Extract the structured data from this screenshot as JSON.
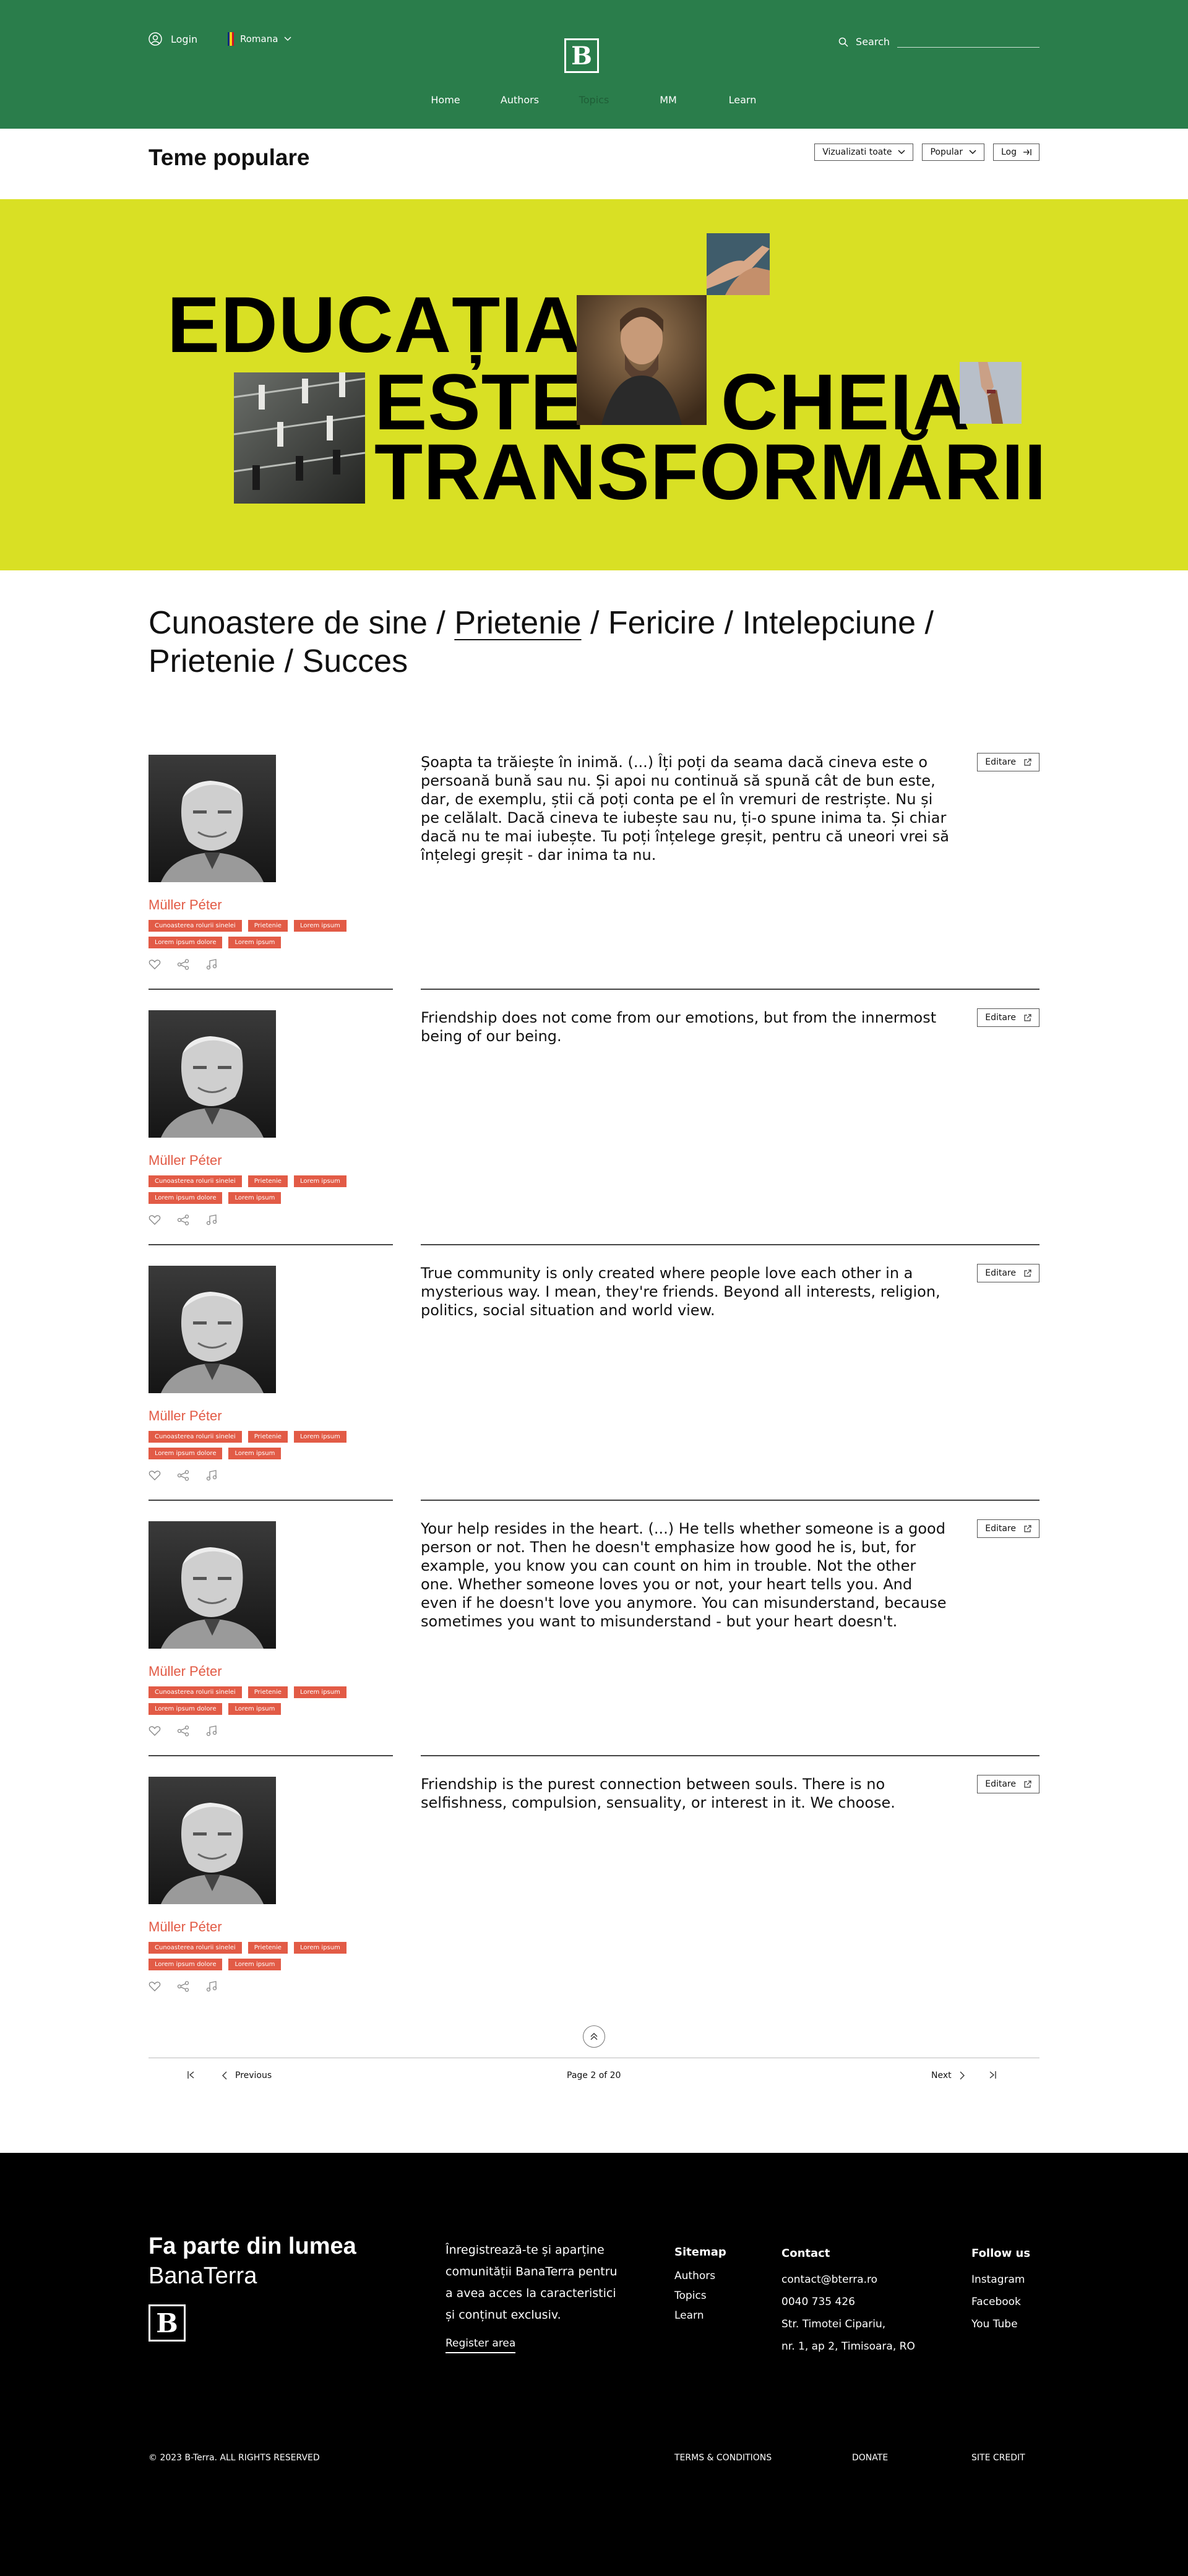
{
  "header": {
    "login": "Login",
    "language": "Romana",
    "logo": "B",
    "search_label": "Search",
    "nav": [
      "Home",
      "Authors",
      "Topics",
      "MM",
      "Learn"
    ]
  },
  "topics": {
    "title": "Teme populare",
    "filter_all": "Vizualizati toate",
    "sort": "Popular",
    "log": "Log"
  },
  "hero": {
    "line1": "EDUCAȚIA",
    "line2a": "ESTE",
    "line2b": "CHEIA",
    "line3": "TRANSFORMĂRII"
  },
  "tagline": {
    "before": "Cunoastere de sine / ",
    "active": "Prietenie",
    "after": " / Fericire / Intelepciune / Prietenie / Succes"
  },
  "quotes": [
    {
      "author": "Müller Péter",
      "text": "Șoapta ta trăiește în inimă. (...) Îți poți da seama dacă cineva este o persoană bună sau nu. Și apoi nu continuă să spună cât de bun este, dar, de exemplu, știi că poți conta pe el în vremuri de restriște. Nu și pe celălalt. Dacă cineva te iubește sau nu, ți-o spune inima ta. Și chiar dacă nu te mai iubește. Tu poți înțelege greșit, pentru că uneori vrei să înțelegi greșit - dar inima ta nu.",
      "tags": [
        "Cunoasterea rolurii sinelei",
        "Prietenie",
        "Lorem ipsum",
        "Lorem ipsum dolore",
        "Lorem ipsum"
      ],
      "edit": "Editare"
    },
    {
      "author": "Müller Péter",
      "text": "Friendship does not come from our emotions, but from the innermost being of our being.",
      "tags": [
        "Cunoasterea rolurii sinelei",
        "Prietenie",
        "Lorem ipsum",
        "Lorem ipsum dolore",
        "Lorem ipsum"
      ],
      "edit": "Editare"
    },
    {
      "author": "Müller Péter",
      "text": "True community is only created where people love each other in a mysterious way. I mean, they're friends. Beyond all interests, religion, politics, social situation and world view.",
      "tags": [
        "Cunoasterea rolurii sinelei",
        "Prietenie",
        "Lorem ipsum",
        "Lorem ipsum dolore",
        "Lorem ipsum"
      ],
      "edit": "Editare"
    },
    {
      "author": "Müller Péter",
      "text": "Your help resides in the heart. (...) He tells whether someone is a good person or not. Then he doesn't emphasize how good he is, but, for example, you know you can count on him in trouble. Not the other one. Whether someone loves you or not, your heart tells you. And even if he doesn't love you anymore. You can misunderstand, because sometimes you want to misunderstand - but your heart doesn't.",
      "tags": [
        "Cunoasterea rolurii sinelei",
        "Prietenie",
        "Lorem ipsum",
        "Lorem ipsum dolore",
        "Lorem ipsum"
      ],
      "edit": "Editare"
    },
    {
      "author": "Müller Péter",
      "text": "Friendship is the purest connection between souls. There is no selfishness, compulsion, sensuality, or interest in it. We choose.",
      "tags": [
        "Cunoasterea rolurii sinelei",
        "Prietenie",
        "Lorem ipsum",
        "Lorem ipsum dolore",
        "Lorem ipsum"
      ],
      "edit": "Editare"
    }
  ],
  "pagination": {
    "previous": "Previous",
    "page_info": "Page 2 of 20",
    "next": "Next"
  },
  "footer": {
    "title": "Fa parte din lumea",
    "subtitle": "BanaTerra",
    "logo": "B",
    "description": "Înregistrează-te și aparține comunității BanaTerra pentru a avea acces la caracteristici și conținut exclusiv.",
    "register": "Register area",
    "sitemap": {
      "heading": "Sitemap",
      "links": [
        "Authors",
        "Topics",
        "Learn"
      ]
    },
    "contact": {
      "heading": "Contact",
      "lines": [
        "contact@bterra.ro",
        "0040 735 426",
        "Str. Timotei Cipariu,",
        "nr. 1, ap 2, Timisoara, RO"
      ]
    },
    "follow": {
      "heading": "Follow us",
      "links": [
        "Instagram",
        "Facebook",
        "You Tube"
      ]
    },
    "copyright": "© 2023 B-Terra. ALL RIGHTS RESERVED",
    "terms": "TERMS & CONDITIONS",
    "donate": "DONATE",
    "credit": "SITE CREDIT"
  },
  "colors": {
    "header_green": "#2a7d4b",
    "hero_yellow": "#d9e024",
    "accent_red": "#e25b46",
    "footer_black": "#000000"
  }
}
